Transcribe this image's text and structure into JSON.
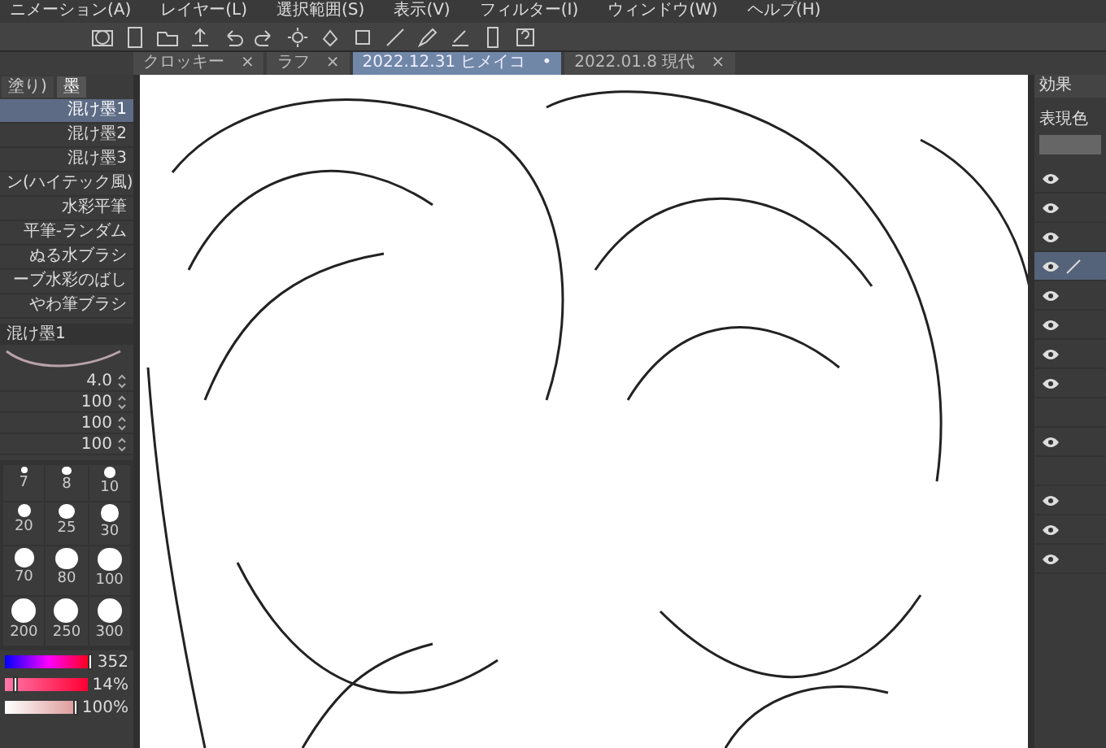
{
  "menu": [
    "ニメーション(A)",
    "レイヤー(L)",
    "選択範囲(S)",
    "表示(V)",
    "フィルター(I)",
    "ウィンドウ(W)",
    "ヘルプ(H)"
  ],
  "tabs": [
    {
      "label": "クロッキー",
      "selected": false,
      "mark": "×"
    },
    {
      "label": "ラフ",
      "selected": false,
      "mark": "×"
    },
    {
      "label": "2022.12.31 ヒメイコ",
      "selected": true,
      "mark": "•"
    },
    {
      "label": "2022.01.8 現代",
      "selected": false,
      "mark": "×"
    }
  ],
  "left_panel": {
    "tabs": [
      {
        "label": "塗り)",
        "selected": false
      },
      {
        "label": "墨",
        "selected": true
      }
    ],
    "brushes": [
      {
        "label": "混け墨1",
        "selected": true
      },
      {
        "label": "混け墨2",
        "selected": false
      },
      {
        "label": "混け墨3",
        "selected": false
      },
      {
        "label": "ン(ハイテック風)",
        "selected": false
      },
      {
        "label": "水彩平筆",
        "selected": false
      },
      {
        "label": "平筆-ランダム",
        "selected": false
      },
      {
        "label": "ぬる水ブラシ",
        "selected": false
      },
      {
        "label": "ーブ水彩のばし",
        "selected": false
      },
      {
        "label": "やわ筆ブラシ",
        "selected": false
      }
    ],
    "property_title": "混け墨1",
    "properties": [
      "4.0",
      "100",
      "100",
      "100"
    ],
    "brush_sizes": [
      "7",
      "8",
      "10",
      "20",
      "25",
      "30",
      "70",
      "80",
      "100",
      "200",
      "250",
      "300"
    ],
    "color_readings": [
      {
        "kind": "hue",
        "value": "352",
        "level": 0.98
      },
      {
        "kind": "saturation",
        "value": "14%",
        "level": 0.14
      },
      {
        "kind": "brightness",
        "value": "100%",
        "level": 1
      }
    ]
  },
  "right_panel": {
    "tab": "効果",
    "label": "表現色",
    "layers": [
      {
        "visible": true,
        "selected": false
      },
      {
        "visible": true,
        "selected": false
      },
      {
        "visible": true,
        "selected": false
      },
      {
        "visible": true,
        "selected": true
      },
      {
        "visible": true,
        "selected": false
      },
      {
        "visible": true,
        "selected": false
      },
      {
        "visible": true,
        "selected": false
      },
      {
        "visible": true,
        "selected": false
      },
      {
        "visible": false,
        "selected": false
      },
      {
        "visible": true,
        "selected": false
      },
      {
        "visible": false,
        "selected": false
      },
      {
        "visible": true,
        "selected": false
      },
      {
        "visible": true,
        "selected": false
      },
      {
        "visible": true,
        "selected": false
      }
    ]
  }
}
